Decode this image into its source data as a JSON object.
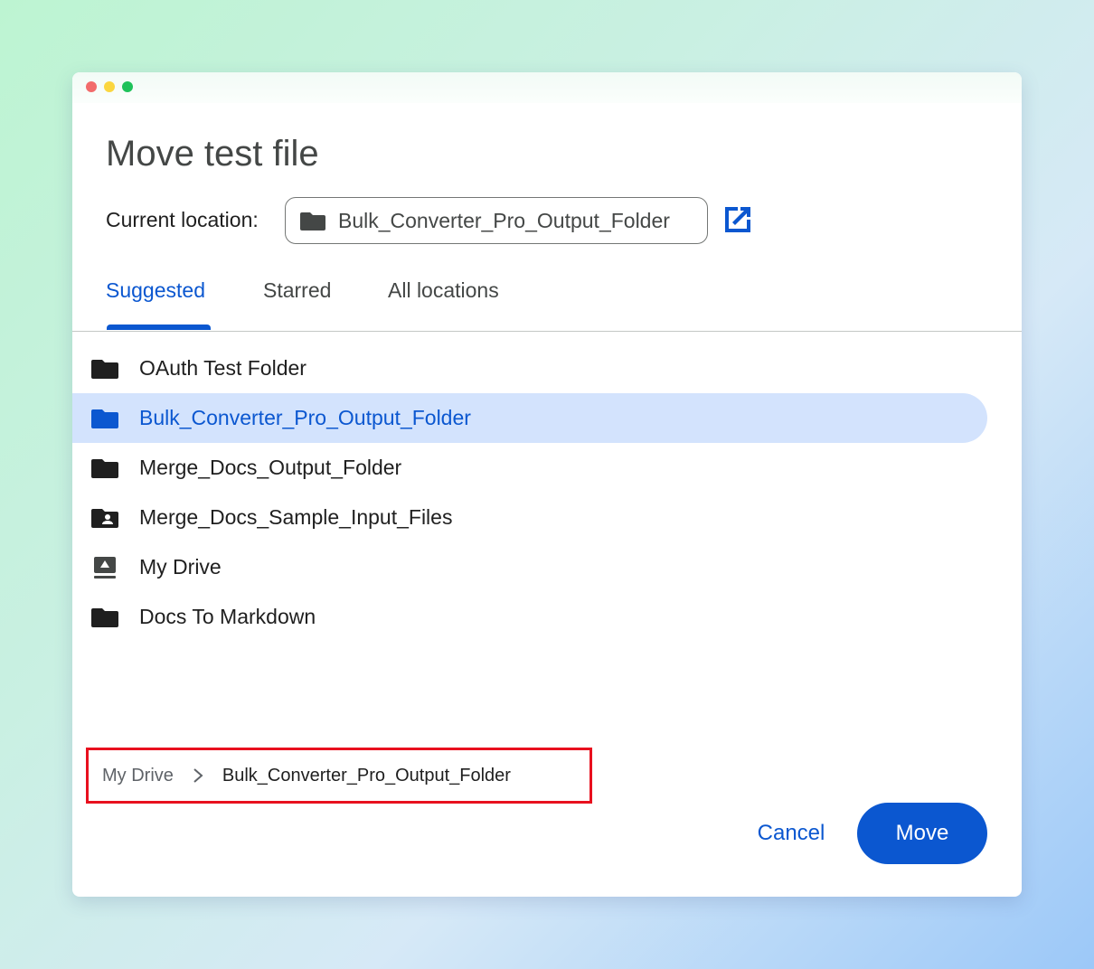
{
  "dialog": {
    "title": "Move test file",
    "current_location_label": "Current location:",
    "current_location_value": "Bulk_Converter_Pro_Output_Folder",
    "open_location_icon": "open-in-new-icon"
  },
  "tabs": [
    {
      "label": "Suggested",
      "active": true
    },
    {
      "label": "Starred",
      "active": false
    },
    {
      "label": "All locations",
      "active": false
    }
  ],
  "folders": [
    {
      "label": "OAuth Test Folder",
      "icon": "folder-icon",
      "selected": false
    },
    {
      "label": "Bulk_Converter_Pro_Output_Folder",
      "icon": "folder-icon",
      "selected": true
    },
    {
      "label": "Merge_Docs_Output_Folder",
      "icon": "folder-icon",
      "selected": false
    },
    {
      "label": "Merge_Docs_Sample_Input_Files",
      "icon": "shared-folder-icon",
      "selected": false
    },
    {
      "label": "My Drive",
      "icon": "drive-icon",
      "selected": false
    },
    {
      "label": "Docs To Markdown",
      "icon": "folder-icon",
      "selected": false
    }
  ],
  "breadcrumb": {
    "root": "My Drive",
    "separator_icon": "chevron-right-icon",
    "current": "Bulk_Converter_Pro_Output_Folder"
  },
  "actions": {
    "cancel_label": "Cancel",
    "move_label": "Move"
  },
  "colors": {
    "accent": "#0b57d0",
    "selected_row": "#d3e3fd",
    "highlight_box": "#e8101e"
  }
}
